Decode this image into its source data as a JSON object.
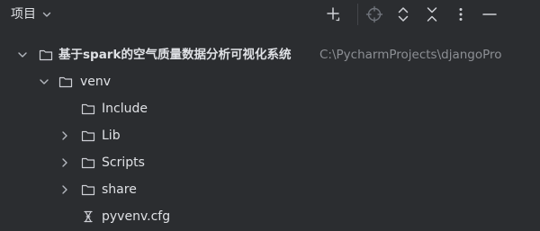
{
  "header": {
    "title": "项目",
    "toolbar": {
      "add_icon": "plus-icon",
      "locate_icon": "target-icon",
      "expand_icon": "expand-all-icon",
      "collapse_icon": "collapse-all-icon",
      "options_icon": "more-vertical-icon",
      "hide_icon": "minimize-icon"
    }
  },
  "tree": {
    "root": {
      "label": "基于spark的空气质量数据分析可视化系统",
      "path": "C:\\PycharmProjects\\djangoPro",
      "expanded": true
    },
    "venv": {
      "label": "venv",
      "expanded": true
    },
    "children": [
      {
        "label": "Include",
        "type": "folder",
        "expandable": false
      },
      {
        "label": "Lib",
        "type": "folder",
        "expandable": true
      },
      {
        "label": "Scripts",
        "type": "folder",
        "expandable": true
      },
      {
        "label": "share",
        "type": "folder",
        "expandable": true
      },
      {
        "label": "pyvenv.cfg",
        "type": "config-file",
        "expandable": false
      }
    ]
  },
  "colors": {
    "background": "#2b2d30",
    "text": "#dfe1e5",
    "path_text": "#8c8f94",
    "icon": "#b4b8bf"
  }
}
